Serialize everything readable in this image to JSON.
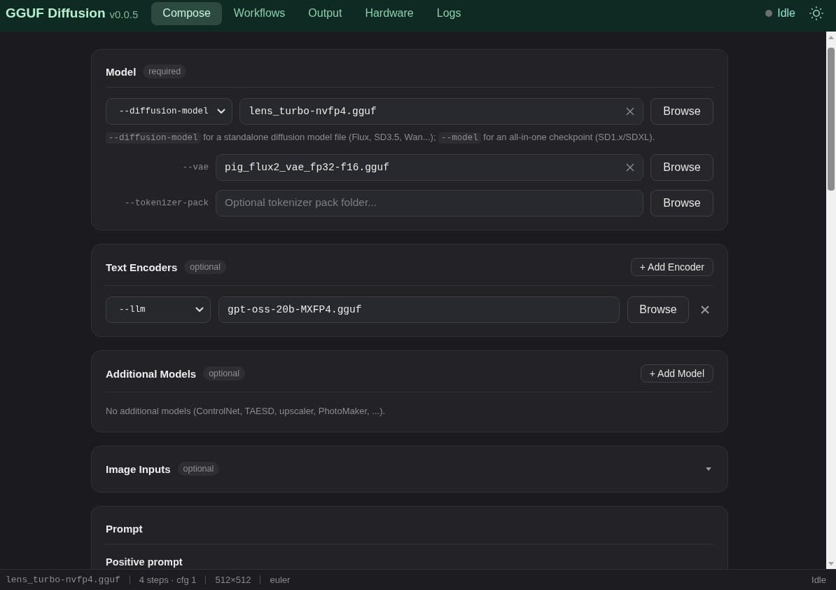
{
  "app": {
    "title": "GGUF Diffusion",
    "version": "v0.0.5"
  },
  "tabs": [
    {
      "label": "Compose",
      "selected": true
    },
    {
      "label": "Workflows",
      "selected": false
    },
    {
      "label": "Output",
      "selected": false
    },
    {
      "label": "Hardware",
      "selected": false
    },
    {
      "label": "Logs",
      "selected": false
    }
  ],
  "status": {
    "label": "Idle",
    "busy": false
  },
  "sections": [
    {
      "kind": "files",
      "title": "Model",
      "badge": "required",
      "primary": {
        "flag": "--diffusion-model",
        "value": "lens_turbo-nvfp4.gguf",
        "button": "Browse"
      },
      "hint": [
        {
          "kind": "code",
          "text": "--diffusion-model"
        },
        {
          "kind": "text",
          "text": "for a standalone diffusion model file (Flux, SD3.5, Wan...);"
        },
        {
          "kind": "code",
          "text": "--model"
        },
        {
          "kind": "text",
          "text": "for an all-in-one checkpoint (SD1.x/SDXL)."
        }
      ],
      "fields": [
        {
          "label": "--vae",
          "value": "pig_flux2_vae_fp32-f16.gguf",
          "button": "Browse"
        },
        {
          "label": "--tokenizer-pack",
          "placeholder": "Optional tokenizer pack folder...",
          "button": "Browse"
        }
      ]
    },
    {
      "kind": "list",
      "title": "Text Encoders",
      "badge": "optional",
      "add_button": "+ Add Encoder",
      "rows": [
        {
          "flag": "--llm",
          "value": "gpt-oss-20b-MXFP4.gguf",
          "button": "Browse"
        }
      ]
    },
    {
      "kind": "list",
      "title": "Additional Models",
      "badge": "optional",
      "add_button": "+ Add Model",
      "empty_text": "No additional models (ControlNet, TAESD, upscaler, PhotoMaker, ...)."
    },
    {
      "kind": "collapsible",
      "title": "Image Inputs",
      "badge": "optional",
      "expanded": false
    },
    {
      "kind": "prompt",
      "title": "Prompt",
      "label": "Positive prompt"
    }
  ],
  "status_bar": {
    "items": [
      {
        "kind": "mono",
        "text": "lens_turbo-nvfp4.gguf"
      },
      {
        "kind": "text",
        "text": "4 steps · cfg 1"
      },
      {
        "kind": "text",
        "text": "512×512"
      },
      {
        "kind": "text",
        "text": "euler"
      }
    ],
    "state": "Idle"
  }
}
